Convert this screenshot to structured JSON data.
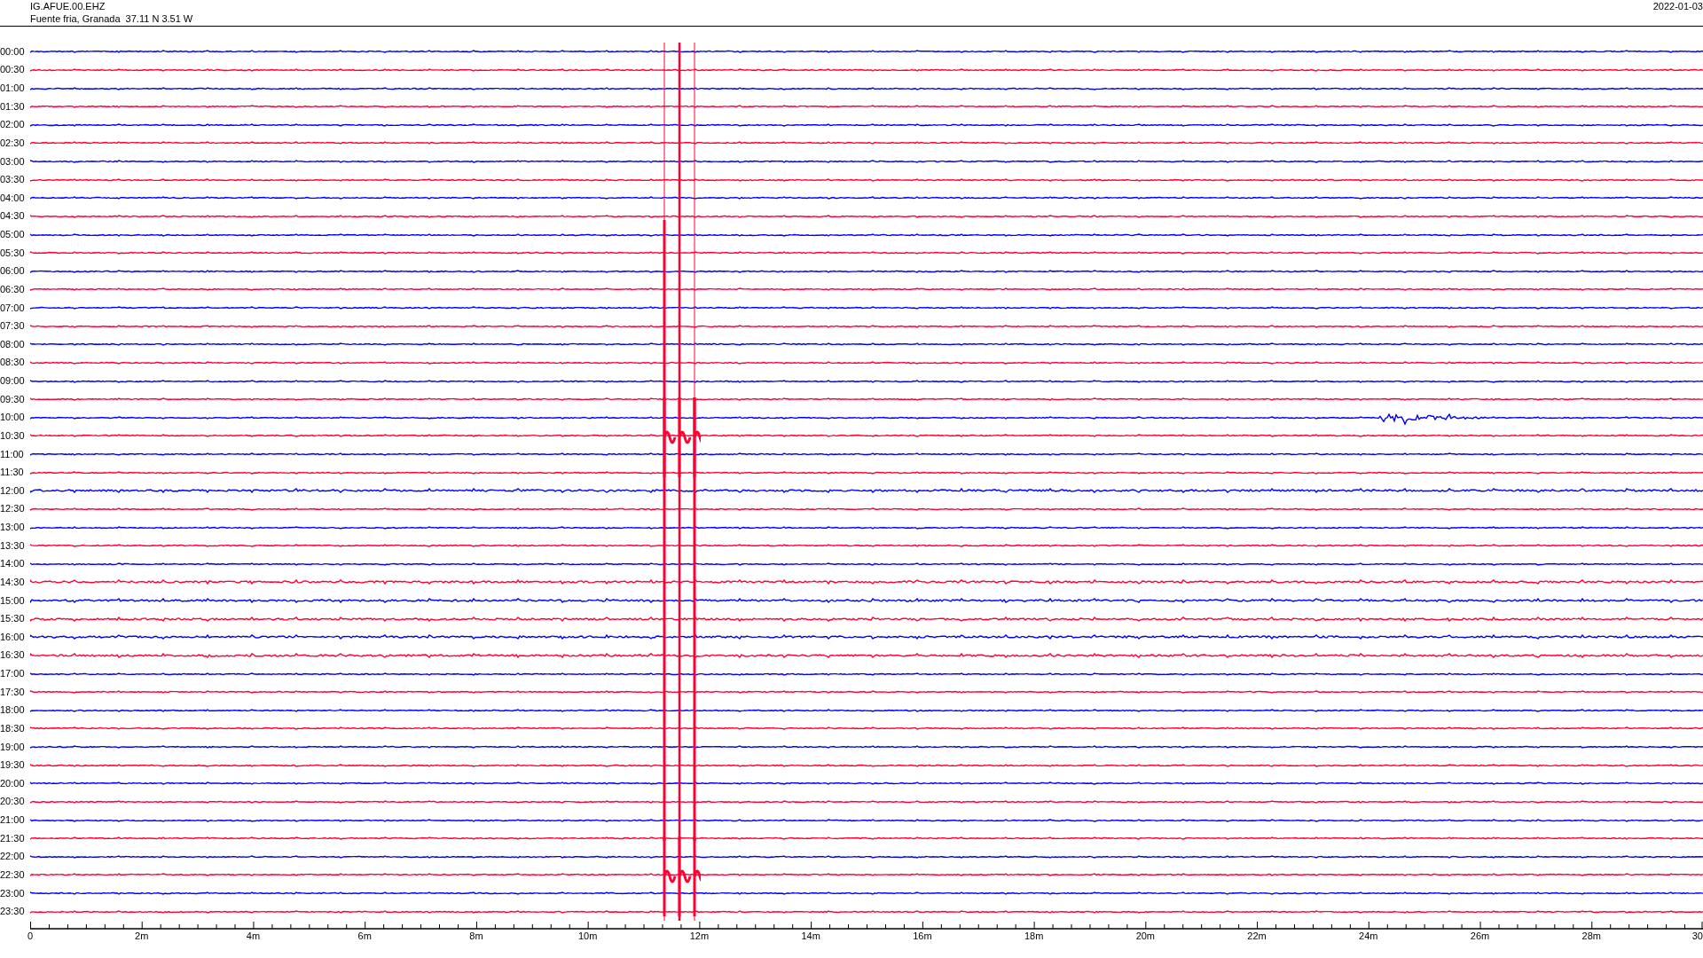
{
  "header": {
    "station": "IG.AFUE.00.EHZ",
    "location": "Fuente fria, Granada  37.11 N 3.51 W",
    "date": "2022-01-03"
  },
  "rows": [
    {
      "time": "00:00",
      "color": "#0000ff"
    },
    {
      "time": "00:30",
      "color": "#ff0033"
    },
    {
      "time": "01:00",
      "color": "#0000ff"
    },
    {
      "time": "01:30",
      "color": "#ff0033"
    },
    {
      "time": "02:00",
      "color": "#0000ff"
    },
    {
      "time": "02:30",
      "color": "#ff0033"
    },
    {
      "time": "03:00",
      "color": "#0000ff"
    },
    {
      "time": "03:30",
      "color": "#ff0033"
    },
    {
      "time": "04:00",
      "color": "#0000ff"
    },
    {
      "time": "04:30",
      "color": "#ff0033"
    },
    {
      "time": "05:00",
      "color": "#0000ff"
    },
    {
      "time": "05:30",
      "color": "#ff0033"
    },
    {
      "time": "06:00",
      "color": "#0000ff"
    },
    {
      "time": "06:30",
      "color": "#ff0033"
    },
    {
      "time": "07:00",
      "color": "#0000ff"
    },
    {
      "time": "07:30",
      "color": "#ff0033"
    },
    {
      "time": "08:00",
      "color": "#0000ff"
    },
    {
      "time": "08:30",
      "color": "#ff0033"
    },
    {
      "time": "09:00",
      "color": "#0000ff"
    },
    {
      "time": "09:30",
      "color": "#ff0033"
    },
    {
      "time": "10:00",
      "color": "#0000ff"
    },
    {
      "time": "10:30",
      "color": "#ff0033"
    },
    {
      "time": "11:00",
      "color": "#0000ff"
    },
    {
      "time": "11:30",
      "color": "#ff0033"
    },
    {
      "time": "12:00",
      "color": "#0000ff"
    },
    {
      "time": "12:30",
      "color": "#ff0033"
    },
    {
      "time": "13:00",
      "color": "#0000ff"
    },
    {
      "time": "13:30",
      "color": "#ff0033"
    },
    {
      "time": "14:00",
      "color": "#0000ff"
    },
    {
      "time": "14:30",
      "color": "#ff0033"
    },
    {
      "time": "15:00",
      "color": "#0000ff"
    },
    {
      "time": "15:30",
      "color": "#ff0033"
    },
    {
      "time": "16:00",
      "color": "#0000ff"
    },
    {
      "time": "16:30",
      "color": "#ff0033"
    },
    {
      "time": "17:00",
      "color": "#0000ff"
    },
    {
      "time": "17:30",
      "color": "#ff0033"
    },
    {
      "time": "18:00",
      "color": "#0000ff"
    },
    {
      "time": "18:30",
      "color": "#ff0033"
    },
    {
      "time": "19:00",
      "color": "#0000ff"
    },
    {
      "time": "19:30",
      "color": "#ff0033"
    },
    {
      "time": "20:00",
      "color": "#0000ff"
    },
    {
      "time": "20:30",
      "color": "#ff0033"
    },
    {
      "time": "21:00",
      "color": "#0000ff"
    },
    {
      "time": "21:30",
      "color": "#ff0033"
    },
    {
      "time": "22:00",
      "color": "#0000ff"
    },
    {
      "time": "22:30",
      "color": "#ff0033"
    },
    {
      "time": "23:00",
      "color": "#0000ff"
    },
    {
      "time": "23:30",
      "color": "#ff0033"
    }
  ],
  "x_axis": {
    "labels": [
      "0",
      "2m",
      "4m",
      "6m",
      "8m",
      "10m",
      "12m",
      "14m",
      "16m",
      "18m",
      "20m",
      "22m",
      "24m",
      "26m",
      "28m",
      "30"
    ]
  }
}
